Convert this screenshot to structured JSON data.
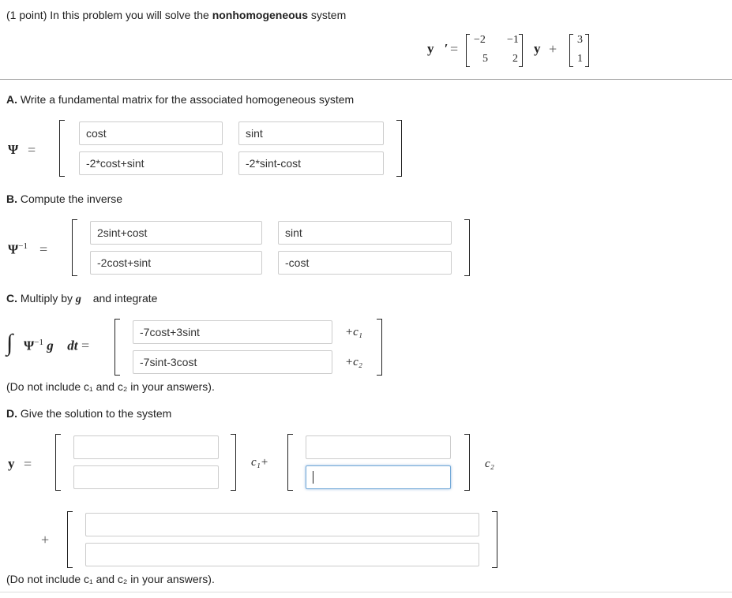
{
  "intro": {
    "prefix": "(1 point) In this problem you will solve the ",
    "bold": "nonhomogeneous",
    "suffix": " system"
  },
  "system": {
    "lhs": "y⃗′",
    "eq": "=",
    "matrix": [
      "−2",
      "−1",
      "5",
      "2"
    ],
    "y": "y⃗",
    "plus": "+",
    "g": [
      "3",
      "1"
    ]
  },
  "partA": {
    "title": "A.",
    "text": " Write a fundamental matrix for the associated homogeneous system",
    "symbol": "Ψ",
    "eq": "=",
    "values": [
      "cost",
      "sint",
      "-2*cost+sint",
      "-2*sint-cost"
    ]
  },
  "partB": {
    "title": "B.",
    "text": " Compute the inverse",
    "symbol": "Ψ",
    "sup": "−1",
    "eq": "=",
    "values": [
      "2sint+cost",
      "sint",
      "-2cost+sint",
      "-cost"
    ]
  },
  "partC": {
    "title": "C.",
    "text_pre": " Multiply by ",
    "g": "g⃗",
    "text_post": " and integrate",
    "integral": "∫",
    "symbol": "Ψ",
    "sup": "−1",
    "g2": "g⃗",
    "dt": "dt",
    "eq": "=",
    "values": [
      "-7cost+3sint",
      "-7sint-3cost"
    ],
    "c1": "+c₁",
    "c2": "+c₂",
    "note": "(Do not include c₁ and c₂ in your answers)."
  },
  "partD": {
    "title": "D.",
    "text": " Give the solution to the system",
    "y": "y⃗",
    "eq": "=",
    "c1": "c₁+",
    "c2": "c₂",
    "plus": "+",
    "values": [
      "",
      "",
      "",
      "",
      "",
      ""
    ],
    "note": "(Do not include c₁ and c₂ in your answers)."
  }
}
